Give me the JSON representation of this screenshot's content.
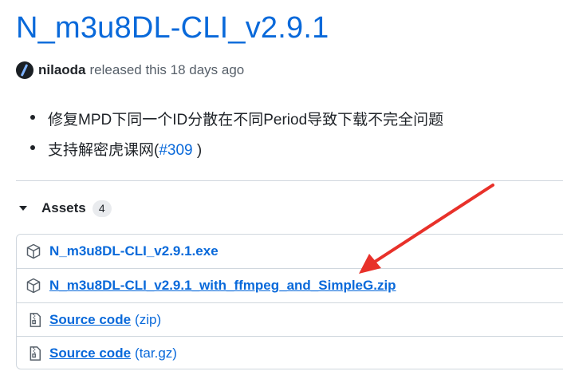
{
  "release": {
    "title": "N_m3u8DL-CLI_v2.9.1",
    "author": "nilaoda",
    "released_text": "released this 18 days ago"
  },
  "notes": {
    "item1": "修复MPD下同一个ID分散在不同Period导致下载不完全问题",
    "item2_prefix": "支持解密虎课网(",
    "item2_link": "#309",
    "item2_suffix": " )"
  },
  "assets": {
    "label": "Assets",
    "count": "4",
    "items": [
      {
        "name": "N_m3u8DL-CLI_v2.9.1.exe",
        "icon": "package-icon"
      },
      {
        "name": "N_m3u8DL-CLI_v2.9.1_with_ffmpeg_and_SimpleG.zip",
        "icon": "package-icon"
      }
    ],
    "sources": [
      {
        "name": "Source code",
        "suffix": "(zip)",
        "icon": "file-zip-icon"
      },
      {
        "name": "Source code",
        "suffix": "(tar.gz)",
        "icon": "file-zip-icon"
      }
    ]
  },
  "colors": {
    "link": "#0969da",
    "arrow": "#e8312a",
    "border": "#d0d7de"
  }
}
